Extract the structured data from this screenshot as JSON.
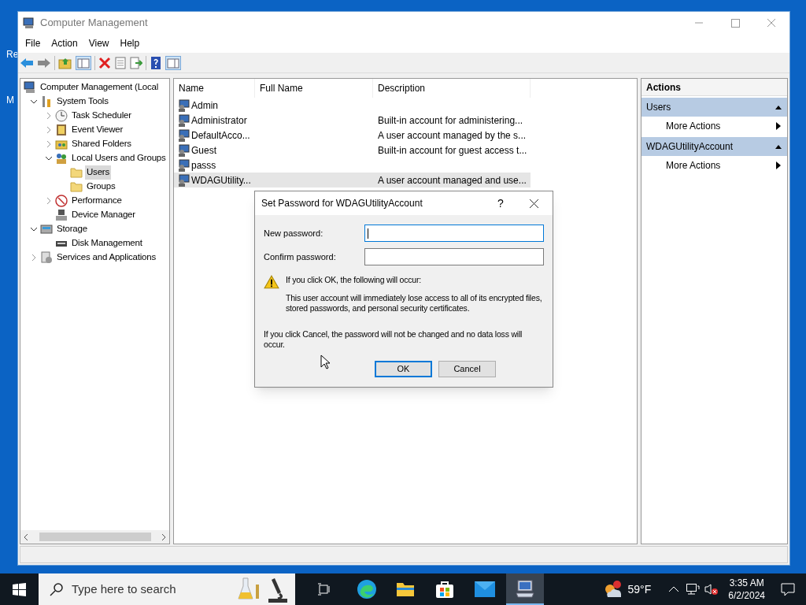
{
  "desktop_icons": [
    {
      "label": "Re"
    },
    {
      "label": "M"
    }
  ],
  "window": {
    "title": "Computer Management"
  },
  "menu": [
    "File",
    "Action",
    "View",
    "Help"
  ],
  "tree": [
    {
      "label": "Computer Management (Local",
      "selected": false,
      "children": [
        {
          "label": "System Tools",
          "expanded": true,
          "selected": false,
          "children": [
            {
              "label": "Task Scheduler",
              "expanded": false,
              "selected": false
            },
            {
              "label": "Event Viewer",
              "expanded": false,
              "selected": false
            },
            {
              "label": "Shared Folders",
              "expanded": false,
              "selected": false
            },
            {
              "label": "Local Users and Groups",
              "expanded": true,
              "selected": false,
              "children": [
                {
                  "label": "Users",
                  "selected": true
                },
                {
                  "label": "Groups",
                  "selected": false
                }
              ]
            },
            {
              "label": "Performance",
              "expanded": false,
              "selected": false
            },
            {
              "label": "Device Manager",
              "selected": false
            }
          ]
        },
        {
          "label": "Storage",
          "expanded": true,
          "selected": false,
          "children": [
            {
              "label": "Disk Management",
              "selected": false
            }
          ]
        },
        {
          "label": "Services and Applications",
          "expanded": false,
          "selected": false
        }
      ]
    }
  ],
  "table": {
    "columns": [
      "Name",
      "Full Name",
      "Description"
    ],
    "rows": [
      {
        "name": "Admin",
        "selected": false
      },
      {
        "name": "Administrator",
        "description": "Built-in account for administering...",
        "selected": false
      },
      {
        "name": "DefaultAcco...",
        "description": "A user account managed by the s...",
        "selected": false
      },
      {
        "name": "Guest",
        "description": "Built-in account for guest access t...",
        "selected": false
      },
      {
        "name": "passs",
        "selected": false
      },
      {
        "name": "WDAGUtility...",
        "description": "A user account managed and use...",
        "selected": true
      }
    ]
  },
  "actions": {
    "title": "Actions",
    "sections": [
      {
        "title": "Users",
        "expanded": true,
        "items": [
          "More Actions"
        ]
      },
      {
        "title": "WDAGUtilityAccount",
        "expanded": true,
        "items": [
          "More Actions"
        ]
      }
    ]
  },
  "dialog": {
    "title": "Set Password for WDAGUtilityAccount",
    "help": "?",
    "fields": [
      {
        "label": "New password:",
        "focused": true
      },
      {
        "label": "Confirm password:",
        "focused": false
      }
    ],
    "warning_heading": "If you click OK, the following will occur:",
    "warning_body": "This user account will immediately lose access to all of its encrypted files, stored passwords, and personal security certificates.",
    "cancel_note": "If you click Cancel, the password will not be changed and no data loss will occur.",
    "buttons": [
      {
        "label": "OK",
        "default": true
      },
      {
        "label": "Cancel",
        "default": false
      }
    ]
  },
  "taskbar": {
    "search_placeholder": "Type here to search",
    "weather": "59°F",
    "time": "3:35 AM",
    "date": "6/2/2024"
  }
}
